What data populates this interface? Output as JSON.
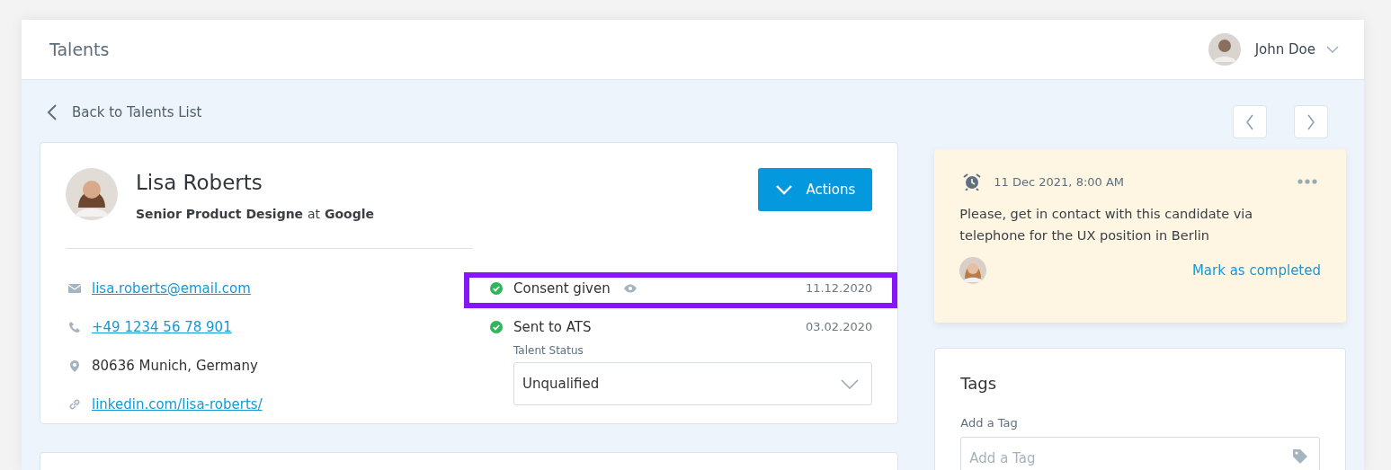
{
  "header": {
    "title": "Talents",
    "user": {
      "name": "John Doe"
    }
  },
  "back_link": "Back to Talents List",
  "profile": {
    "name": "Lisa Roberts",
    "role": "Senior Product Designe",
    "at": "at",
    "company": "Google",
    "actions_button": "Actions",
    "contacts": [
      {
        "kind": "email",
        "text": "lisa.roberts@email.com",
        "link": true
      },
      {
        "kind": "phone",
        "text": "+49 1234 56 78 901",
        "link": true
      },
      {
        "kind": "location",
        "text": "80636 Munich, Germany",
        "link": false
      },
      {
        "kind": "web",
        "text": "linkedin.com/lisa-roberts/",
        "link": true
      }
    ],
    "statuses": [
      {
        "label": "Consent given",
        "date": "11.12.2020",
        "done": true,
        "viewable": true,
        "highlighted": true
      },
      {
        "label": "Sent to ATS",
        "date": "03.02.2020",
        "done": true,
        "viewable": false,
        "highlighted": false
      }
    ],
    "talent_status": {
      "label": "Talent Status",
      "value": "Unqualified"
    }
  },
  "reminder": {
    "time": "11 Dec 2021, 8:00 AM",
    "text": "Please, get in contact with this candidate via telephone for the UX position in Berlin",
    "action": "Mark as completed"
  },
  "tags": {
    "title": "Tags",
    "label": "Add a Tag",
    "placeholder": "Add a Tag"
  }
}
